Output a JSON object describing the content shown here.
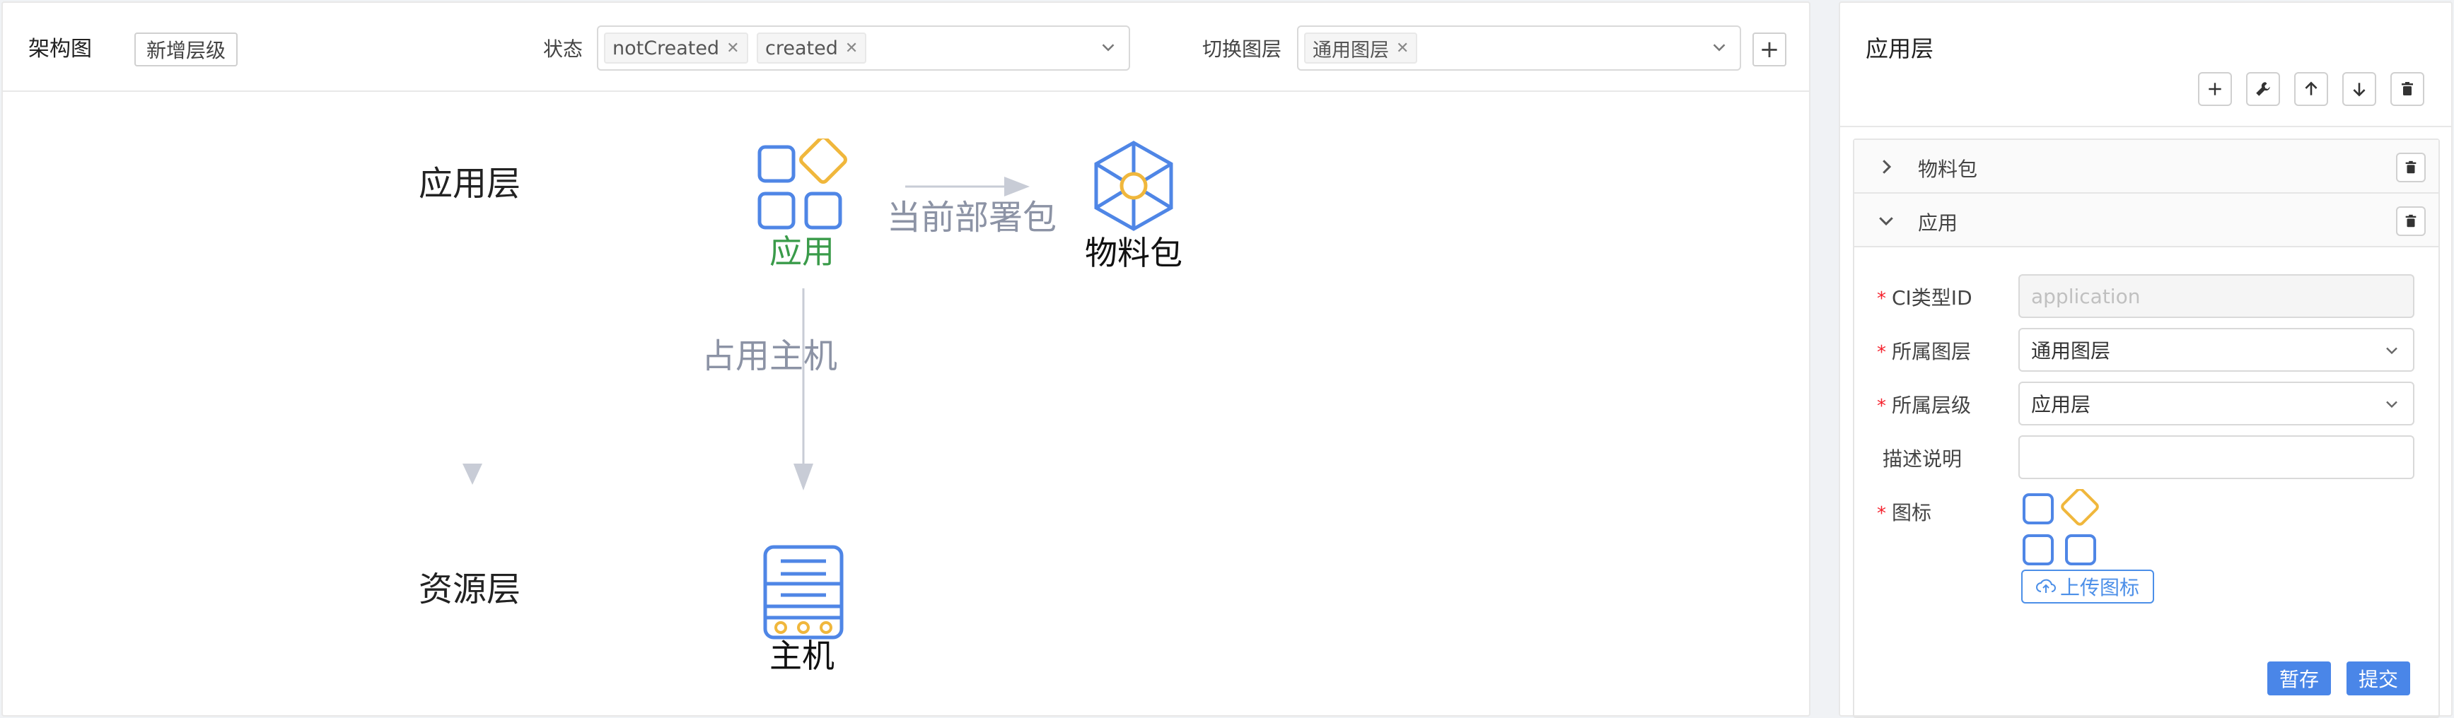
{
  "toolbar": {
    "title": "架构图",
    "add_level_button": "新增层级",
    "status_label": "状态",
    "status_tags": [
      "notCreated",
      "created"
    ],
    "layer_label": "切换图层",
    "layer_tags": [
      "通用图层"
    ],
    "add_button": "+"
  },
  "diagram": {
    "layers": [
      "应用层",
      "资源层"
    ],
    "nodes": {
      "app": "应用",
      "package": "物料包",
      "host": "主机"
    },
    "edges": {
      "deploy": "当前部署包",
      "occupy": "占用主机"
    },
    "colors": {
      "blue": "#4f86e6",
      "yellow": "#f0b73c",
      "green": "#3a9b4a",
      "edge": "#c8ccd6"
    }
  },
  "right_panel": {
    "title": "应用层",
    "toolbar_icons": [
      "plus-icon",
      "wrench-icon",
      "arrow-up-icon",
      "arrow-down-icon",
      "trash-icon"
    ],
    "sections": [
      {
        "name": "物料包",
        "expanded": false
      },
      {
        "name": "应用",
        "expanded": true
      }
    ],
    "form": {
      "ci_type_label": "CI类型ID",
      "ci_type_placeholder": "application",
      "layer_label": "所属图层",
      "layer_value": "通用图层",
      "level_label": "所属层级",
      "level_value": "应用层",
      "desc_label": "描述说明",
      "desc_value": "",
      "icon_label": "图标",
      "upload_label": "上传图标",
      "save_button": "暂存",
      "submit_button": "提交"
    }
  }
}
